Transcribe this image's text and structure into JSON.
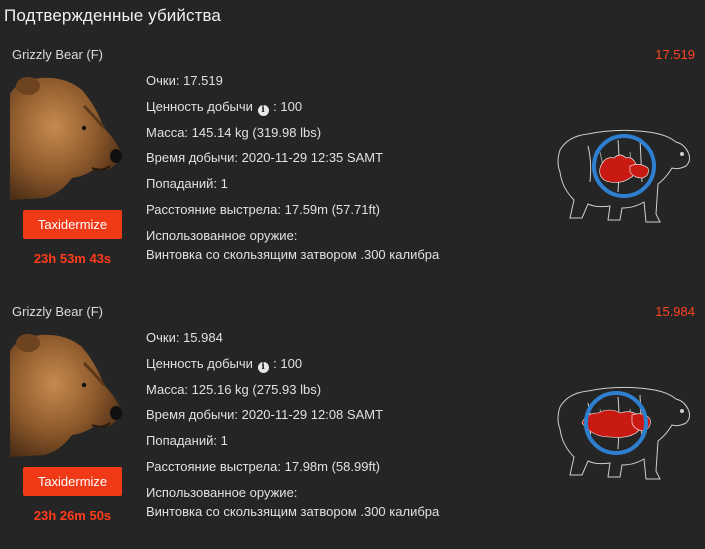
{
  "page": {
    "title": "Подтвержденные убийства"
  },
  "labels": {
    "score": "Очки:",
    "trophy_value": "Ценность добычи",
    "trophy_value_suffix": ": 100",
    "mass": "Масса:",
    "harvest_time": "Время добычи:",
    "hits": "Попаданий:",
    "shot_distance": "Расстояние выстрела:",
    "weapon": "Использованное оружие:",
    "taxidermize": "Taxidermize"
  },
  "icons": {
    "info": "info-icon",
    "portrait": "grizzly-bear-portrait",
    "shot_map": "bear-shot-placement-diagram"
  },
  "colors": {
    "accent": "#f03a17",
    "score": "#ff4420",
    "circle": "#2f7fd0",
    "organ": "#c81a12"
  },
  "kills": [
    {
      "animal": "Grizzly Bear (F)",
      "score_value": "17.519",
      "score_text": "17.519",
      "mass_text": "145.14 kg (319.98 lbs)",
      "time_text": "2020-11-29 12:35 SAMT",
      "hits_text": "1",
      "distance_text": "17.59m (57.71ft)",
      "weapon_text": "Винтовка со скользящим затвором .300 калибра",
      "timer": "23h 53m 43s"
    },
    {
      "animal": "Grizzly Bear (F)",
      "score_value": "15.984",
      "score_text": "15.984",
      "mass_text": "125.16 kg (275.93 lbs)",
      "time_text": "2020-11-29 12:08 SAMT",
      "hits_text": "1",
      "distance_text": "17.98m (58.99ft)",
      "weapon_text": "Винтовка со скользящим затвором .300 калибра",
      "timer": "23h 26m 50s"
    }
  ]
}
